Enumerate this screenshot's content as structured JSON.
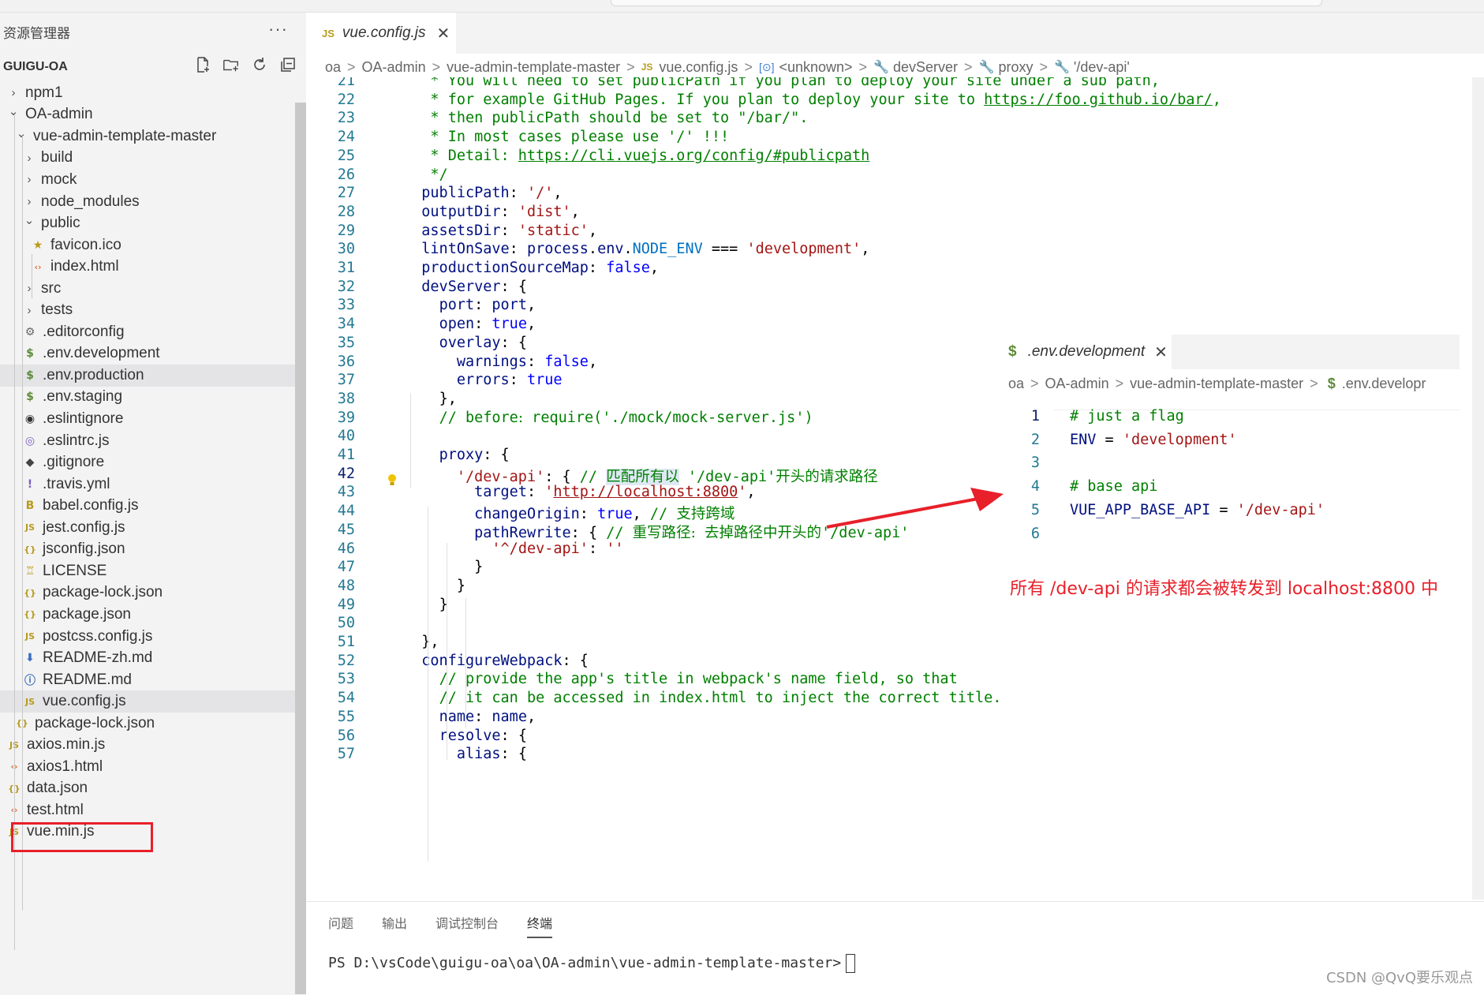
{
  "explorer": {
    "title": "资源管理器",
    "more": "···",
    "section": "GUIGU-OA",
    "items": [
      {
        "label": "npm1",
        "kind": "folder",
        "open": false,
        "depth": 0
      },
      {
        "label": "OA-admin",
        "kind": "folder",
        "open": true,
        "depth": 0
      },
      {
        "label": "vue-admin-template-master",
        "kind": "folder",
        "open": true,
        "depth": 1
      },
      {
        "label": "build",
        "kind": "folder",
        "open": false,
        "depth": 2
      },
      {
        "label": "mock",
        "kind": "folder",
        "open": false,
        "depth": 2
      },
      {
        "label": "node_modules",
        "kind": "folder",
        "open": false,
        "depth": 2
      },
      {
        "label": "public",
        "kind": "folder",
        "open": true,
        "depth": 2
      },
      {
        "label": "favicon.ico",
        "kind": "star",
        "depth": 3
      },
      {
        "label": "index.html",
        "kind": "html",
        "depth": 3
      },
      {
        "label": "src",
        "kind": "folder",
        "open": false,
        "depth": 2
      },
      {
        "label": "tests",
        "kind": "folder",
        "open": false,
        "depth": 2
      },
      {
        "label": ".editorconfig",
        "kind": "gear",
        "depth": 2
      },
      {
        "label": ".env.development",
        "kind": "dollar",
        "depth": 2
      },
      {
        "label": ".env.production",
        "kind": "dollar",
        "depth": 2,
        "highlight": true
      },
      {
        "label": ".env.staging",
        "kind": "dollar",
        "depth": 2
      },
      {
        "label": ".eslintignore",
        "kind": "eslint",
        "depth": 2
      },
      {
        "label": ".eslintrc.js",
        "kind": "eslintrc",
        "depth": 2
      },
      {
        "label": ".gitignore",
        "kind": "git",
        "depth": 2
      },
      {
        "label": ".travis.yml",
        "kind": "bang",
        "depth": 2
      },
      {
        "label": "babel.config.js",
        "kind": "babel",
        "depth": 2
      },
      {
        "label": "jest.config.js",
        "kind": "js",
        "depth": 2
      },
      {
        "label": "jsconfig.json",
        "kind": "json",
        "depth": 2
      },
      {
        "label": "LICENSE",
        "kind": "license",
        "depth": 2
      },
      {
        "label": "package-lock.json",
        "kind": "json",
        "depth": 2
      },
      {
        "label": "package.json",
        "kind": "json",
        "depth": 2
      },
      {
        "label": "postcss.config.js",
        "kind": "js",
        "depth": 2
      },
      {
        "label": "README-zh.md",
        "kind": "download",
        "depth": 2
      },
      {
        "label": "README.md",
        "kind": "info",
        "depth": 2
      },
      {
        "label": "vue.config.js",
        "kind": "js",
        "depth": 2,
        "highlight": true
      },
      {
        "label": "package-lock.json",
        "kind": "json",
        "depth": 1
      },
      {
        "label": "axios.min.js",
        "kind": "js",
        "depth": 0
      },
      {
        "label": "axios1.html",
        "kind": "html",
        "depth": 0
      },
      {
        "label": "data.json",
        "kind": "json",
        "depth": 0
      },
      {
        "label": "test.html",
        "kind": "html",
        "depth": 0
      },
      {
        "label": "vue.min.js",
        "kind": "js",
        "depth": 0
      }
    ]
  },
  "editor": {
    "tab": {
      "icon": "JS",
      "label": "vue.config.js",
      "close": "✕"
    },
    "breadcrumb": [
      "oa",
      "OA-admin",
      "vue-admin-template-master",
      "vue.config.js",
      "<unknown>",
      "devServer",
      "proxy",
      "'/dev-api'"
    ],
    "code": [
      {
        "n": "21",
        "t": "   * You will need to set publicPath if you plan to deploy your site under a sub path,"
      },
      {
        "n": "22",
        "t": "   * for example GitHub Pages. If you plan to deploy your site to https://foo.github.io/bar/,"
      },
      {
        "n": "23",
        "t": "   * then publicPath should be set to \"/bar/\"."
      },
      {
        "n": "24",
        "t": "   * In most cases please use '/' !!!"
      },
      {
        "n": "25",
        "t": "   * Detail: https://cli.vuejs.org/config/#publicpath"
      },
      {
        "n": "26",
        "t": "   */"
      },
      {
        "n": "27",
        "t": "  publicPath: '/',"
      },
      {
        "n": "28",
        "t": "  outputDir: 'dist',"
      },
      {
        "n": "29",
        "t": "  assetsDir: 'static',"
      },
      {
        "n": "30",
        "t": "  lintOnSave: process.env.NODE_ENV === 'development',"
      },
      {
        "n": "31",
        "t": "  productionSourceMap: false,"
      },
      {
        "n": "32",
        "t": "  devServer: {"
      },
      {
        "n": "33",
        "t": "    port: port,"
      },
      {
        "n": "34",
        "t": "    open: true,"
      },
      {
        "n": "35",
        "t": "    overlay: {"
      },
      {
        "n": "36",
        "t": "      warnings: false,"
      },
      {
        "n": "37",
        "t": "      errors: true"
      },
      {
        "n": "38",
        "t": "    },"
      },
      {
        "n": "39",
        "t": "    // before: require('./mock/mock-server.js')"
      },
      {
        "n": "40",
        "t": ""
      },
      {
        "n": "41",
        "t": "    proxy: {"
      },
      {
        "n": "42",
        "t": "      '/dev-api': { // 匹配所有以 '/dev-api'开头的请求路径"
      },
      {
        "n": "43",
        "t": "        target: 'http://localhost:8800',"
      },
      {
        "n": "44",
        "t": "        changeOrigin: true, // 支持跨域"
      },
      {
        "n": "45",
        "t": "        pathRewrite: { // 重写路径: 去掉路径中开头的'/dev-api'"
      },
      {
        "n": "46",
        "t": "          '^/dev-api': ''"
      },
      {
        "n": "47",
        "t": "        }"
      },
      {
        "n": "48",
        "t": "      }"
      },
      {
        "n": "49",
        "t": "    }"
      },
      {
        "n": "50",
        "t": ""
      },
      {
        "n": "51",
        "t": "  },"
      },
      {
        "n": "52",
        "t": "  configureWebpack: {"
      },
      {
        "n": "53",
        "t": "    // provide the app's title in webpack's name field, so that"
      },
      {
        "n": "54",
        "t": "    // it can be accessed in index.html to inject the correct title."
      },
      {
        "n": "55",
        "t": "    name: name,"
      },
      {
        "n": "56",
        "t": "    resolve: {"
      },
      {
        "n": "57",
        "t": "      alias: {"
      }
    ]
  },
  "peek": {
    "tab": {
      "label": ".env.development",
      "close": "✕"
    },
    "breadcrumb": [
      "oa",
      "OA-admin",
      "vue-admin-template-master",
      ".env.developr"
    ],
    "lines": [
      {
        "n": "1",
        "t": "# just a flag"
      },
      {
        "n": "2",
        "t": "ENV = 'development'"
      },
      {
        "n": "3",
        "t": ""
      },
      {
        "n": "4",
        "t": "# base api"
      },
      {
        "n": "5",
        "t": "VUE_APP_BASE_API = '/dev-api'"
      },
      {
        "n": "6",
        "t": ""
      }
    ]
  },
  "annotation": "所有 /dev-api 的请求都会被转发到 localhost:8800 中",
  "panel": {
    "tabs": [
      "问题",
      "输出",
      "调试控制台",
      "终端"
    ],
    "active_tab": "终端",
    "terminal": "PS D:\\vsCode\\guigu-oa\\oa\\OA-admin\\vue-admin-template-master>"
  },
  "watermark": "CSDN @QvQ要乐观点",
  "colors": {
    "accent_red": "#e8202a",
    "comment": "#008000",
    "string": "#a31515",
    "keyword": "#0000ff",
    "property": "#001080"
  }
}
